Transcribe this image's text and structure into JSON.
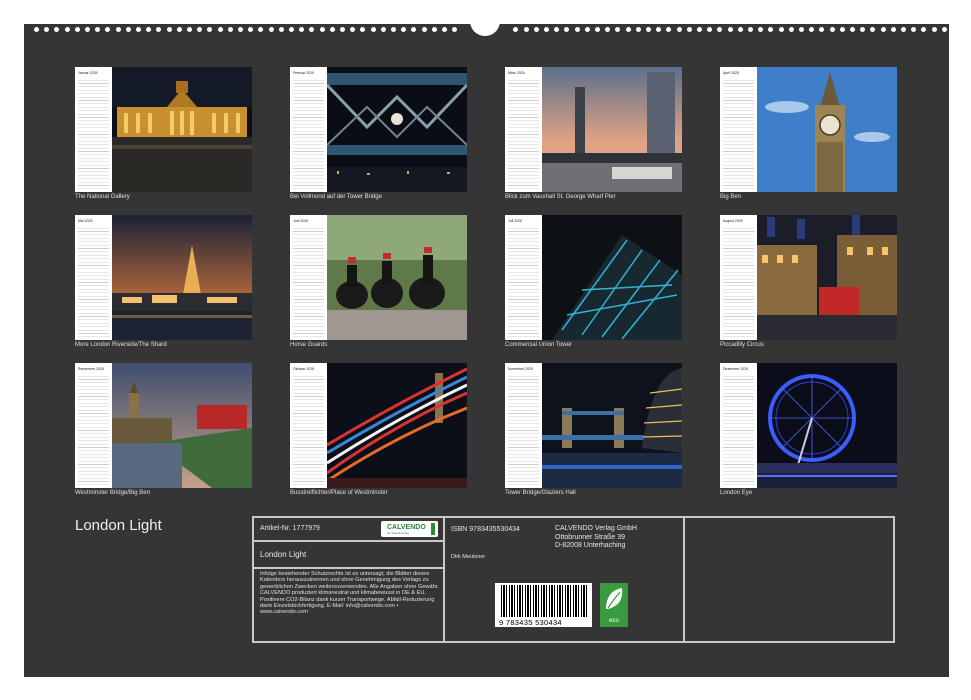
{
  "months": [
    {
      "month": "Januar 2025",
      "caption": "The National Gallery"
    },
    {
      "month": "Februar 2025",
      "caption": "Bei Vollmond auf der Tower Bridge"
    },
    {
      "month": "März 2025",
      "caption": "Blick zum Vauxhall St. George Wharf Pier"
    },
    {
      "month": "April 2025",
      "caption": "Big Ben"
    },
    {
      "month": "Mai 2025",
      "caption": "More London Riverside/The Shard"
    },
    {
      "month": "Juni 2025",
      "caption": "Horse Guards"
    },
    {
      "month": "Juli 2025",
      "caption": "Commercial Union Tower"
    },
    {
      "month": "August 2025",
      "caption": "Piccadilly Circus"
    },
    {
      "month": "September 2025",
      "caption": "Westminster Bridge/Big Ben"
    },
    {
      "month": "Oktober 2025",
      "caption": "Busstreiflichter/Place of Westminster"
    },
    {
      "month": "November 2025",
      "caption": "Tower Bridge/Glaziers Hall"
    },
    {
      "month": "Dezember 2025",
      "caption": "London Eye"
    }
  ],
  "title": "London Light",
  "info": {
    "article": "Artikel-Nr. 1777979",
    "logo_text": "CALVENDO",
    "logo_sub": "Der Kalenderverlag",
    "calendar_title": "London Light",
    "legal": "Infolge bestehender Schutzrechte ist es untersagt, die Blätter dieses Kalenders herauszutrennen und ohne Genehmigung des Verlags zu gewerblichen Zwecken weiterzuverwenden. Alle Angaben ohne Gewähr. CALVENDO produziert klimaneutral und klimabewusst in DE & EU. Positivere CO2-Bilanz dank kurzer Transportwege. Abfall-Reduzierung dank Einzelstückfertigung. E-Mail: info@calvendo.com • www.calvendo.com",
    "isbn": "ISBN 9783435530434",
    "author": "Dirk Meutzner",
    "publisher": [
      "CALVENDO Verlag GmbH",
      "Ottobrunner Straße 39",
      "D-82008 Unterhaching"
    ],
    "barcode_number": "9 783435 530434",
    "eco_label": "eco"
  },
  "colors": {
    "background": "#353535",
    "accent_green": "#3a9a3f"
  }
}
